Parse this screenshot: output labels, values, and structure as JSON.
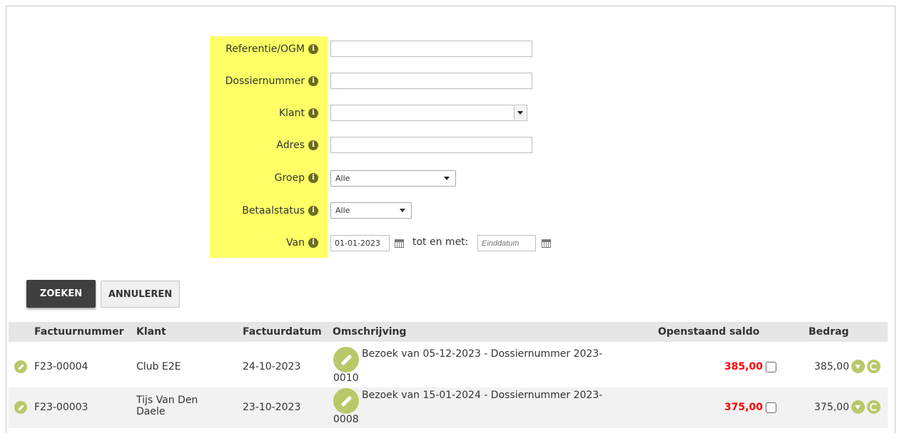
{
  "form": {
    "fields": [
      {
        "label": "Referentie/OGM",
        "type": "text",
        "value": ""
      },
      {
        "label": "Dossiernummer",
        "type": "text",
        "value": ""
      },
      {
        "label": "Klant",
        "type": "combo",
        "value": ""
      },
      {
        "label": "Adres",
        "type": "text",
        "value": ""
      },
      {
        "label": "Groep",
        "type": "select",
        "value": "Alle"
      },
      {
        "label": "Betaalstatus",
        "type": "select",
        "value": "Alle"
      },
      {
        "label": "Van",
        "type": "daterange",
        "value": "01-01-2023"
      }
    ],
    "date_range": {
      "from_value": "01-01-2023",
      "separator": "tot en met:",
      "to_placeholder": "Einddatum"
    },
    "info_icon": "info-icon",
    "highlight_color": "#ffff66"
  },
  "buttons": {
    "search": "ZOEKEN",
    "cancel": "ANNULEREN"
  },
  "table": {
    "columns": [
      "Factuurnummer",
      "Klant",
      "Factuurdatum",
      "Omschrijving",
      "Openstaand saldo",
      "Bedrag"
    ],
    "rows": [
      {
        "invoice": "F23-00004",
        "client": "Club E2E",
        "date": "24-10-2023",
        "desc_line1": "Bezoek van 05-12-2023 - Dossiernummer 2023-",
        "desc_line2": "0010",
        "balance": "385,00",
        "amount": "385,00"
      },
      {
        "invoice": "F23-00003",
        "client_line1": "Tijs Van Den",
        "client_line2": "Daele",
        "date": "23-10-2023",
        "desc_line1": "Bezoek van 15-01-2024 - Dossiernummer 2023-",
        "desc_line2": "0008",
        "balance": "375,00",
        "amount": "375,00"
      }
    ],
    "balance_color": "#ff0000",
    "accent_green": "#b8c96a"
  }
}
